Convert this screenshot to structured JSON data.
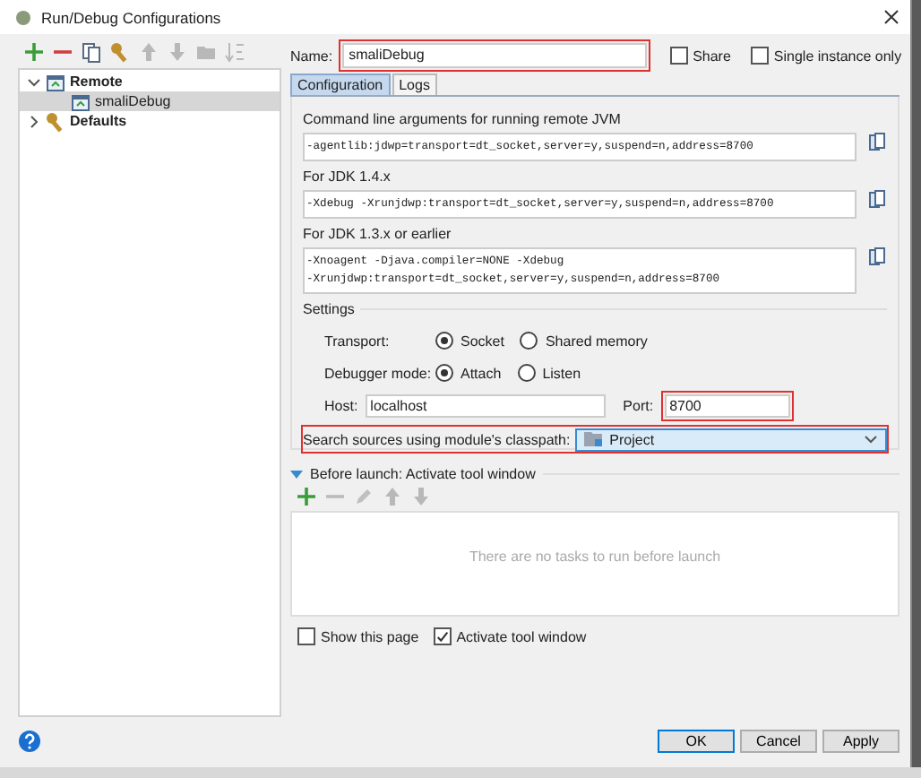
{
  "window": {
    "title": "Run/Debug Configurations"
  },
  "toolbar": [
    {
      "kind": "add",
      "disabled": false
    },
    {
      "kind": "remove",
      "disabled": false
    },
    {
      "kind": "copy",
      "disabled": false
    },
    {
      "kind": "settings",
      "disabled": false
    },
    {
      "kind": "up",
      "disabled": true
    },
    {
      "kind": "down",
      "disabled": true
    },
    {
      "kind": "folder",
      "disabled": true
    },
    {
      "kind": "sort",
      "disabled": true
    }
  ],
  "tree": [
    {
      "label": "Remote",
      "kind": "remote",
      "expanded": true,
      "selected": false,
      "children": [
        {
          "label": "smaliDebug",
          "kind": "config",
          "selected": true
        }
      ]
    },
    {
      "label": "Defaults",
      "kind": "defaults",
      "expanded": false,
      "selected": false
    }
  ],
  "name": {
    "label": "Name:",
    "value": "smaliDebug",
    "highlighted": true
  },
  "options": [
    {
      "label": "Share",
      "checked": false
    },
    {
      "label": "Single instance only",
      "checked": false
    }
  ],
  "tabs": [
    {
      "label": "Configuration",
      "selected": true
    },
    {
      "label": "Logs",
      "selected": false
    }
  ],
  "arguments": [
    {
      "label": "Command line arguments for running remote JVM",
      "lines": [
        "-agentlib:jdwp=transport=dt_socket,server=y,suspend=n,address=8700"
      ]
    },
    {
      "label": "For JDK 1.4.x",
      "lines": [
        "-Xdebug -Xrunjdwp:transport=dt_socket,server=y,suspend=n,address=8700"
      ]
    },
    {
      "label": "For JDK 1.3.x or earlier",
      "lines": [
        "-Xnoagent -Djava.compiler=NONE -Xdebug",
        "-Xrunjdwp:transport=dt_socket,server=y,suspend=n,address=8700"
      ]
    }
  ],
  "settings": {
    "title": "Settings",
    "radio_groups": [
      {
        "label": "Transport:",
        "options": [
          {
            "label": "Socket",
            "selected": true
          },
          {
            "label": "Shared memory",
            "selected": false
          }
        ]
      },
      {
        "label": "Debugger mode:",
        "options": [
          {
            "label": "Attach",
            "selected": true
          },
          {
            "label": "Listen",
            "selected": false
          }
        ]
      }
    ],
    "host": {
      "label": "Host:",
      "value": "localhost"
    },
    "port": {
      "label": "Port:",
      "value": "8700",
      "highlighted": true
    },
    "classpath": {
      "label": "Search sources using module's classpath:",
      "value": "Project",
      "highlighted": true
    }
  },
  "before_launch": {
    "title": "Before launch: Activate tool window",
    "expanded": true,
    "toolbar": [
      {
        "kind": "add",
        "disabled": false
      },
      {
        "kind": "remove",
        "disabled": true
      },
      {
        "kind": "edit",
        "disabled": true
      },
      {
        "kind": "up",
        "disabled": true
      },
      {
        "kind": "down",
        "disabled": true
      }
    ],
    "empty_text": "There are no tasks to run before launch",
    "checkboxes": [
      {
        "label": "Show this page",
        "checked": false
      },
      {
        "label": "Activate tool window",
        "checked": true
      }
    ]
  },
  "buttons": [
    {
      "label": "OK",
      "default": true
    },
    {
      "label": "Cancel",
      "default": false
    },
    {
      "label": "Apply",
      "default": false
    }
  ]
}
